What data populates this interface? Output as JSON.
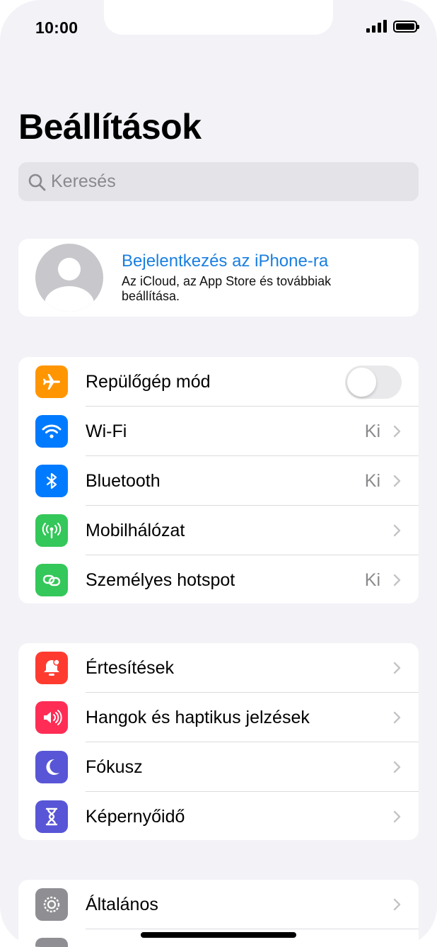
{
  "status_bar": {
    "time": "10:00"
  },
  "title": "Beállítások",
  "search": {
    "placeholder": "Keresés"
  },
  "profile": {
    "title": "Bejelentkezés az iPhone-ra",
    "subtitle": "Az iCloud, az App Store és továbbiak beállítása."
  },
  "group1": [
    {
      "label": "Repülőgép mód",
      "icon": "airplane-icon",
      "color": "#ff9500",
      "toggle": false
    },
    {
      "label": "Wi-Fi",
      "value": "Ki",
      "icon": "wifi-icon",
      "color": "#007aff"
    },
    {
      "label": "Bluetooth",
      "value": "Ki",
      "icon": "bluetooth-icon",
      "color": "#007aff"
    },
    {
      "label": "Mobilhálózat",
      "icon": "antenna-icon",
      "color": "#34c759"
    },
    {
      "label": "Személyes hotspot",
      "value": "Ki",
      "icon": "link-icon",
      "color": "#34c759"
    }
  ],
  "group2": [
    {
      "label": "Értesítések",
      "icon": "bell-icon",
      "color": "#ff3b30"
    },
    {
      "label": "Hangok és haptikus jelzések",
      "icon": "speaker-icon",
      "color": "#ff2d55"
    },
    {
      "label": "Fókusz",
      "icon": "moon-icon",
      "color": "#5856d6"
    },
    {
      "label": "Képernyőidő",
      "icon": "hourglass-icon",
      "color": "#5856d6"
    }
  ],
  "group3": [
    {
      "label": "Általános",
      "icon": "gear-icon",
      "color": "#8e8e93"
    }
  ]
}
